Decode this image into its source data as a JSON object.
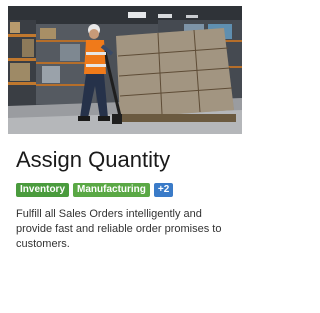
{
  "card": {
    "title": "Assign Quantity",
    "tags": [
      {
        "label": "Inventory",
        "color": "#4a9b3d"
      },
      {
        "label": "Manufacturing",
        "color": "#5aa845"
      },
      {
        "label": "+2",
        "color": "#3a7bc8"
      }
    ],
    "description": "Fulfill all Sales Orders intelligently and provide fast and reliable order promises to customers.",
    "image": {
      "subject": "warehouse-worker-with-pallet-jack"
    }
  }
}
